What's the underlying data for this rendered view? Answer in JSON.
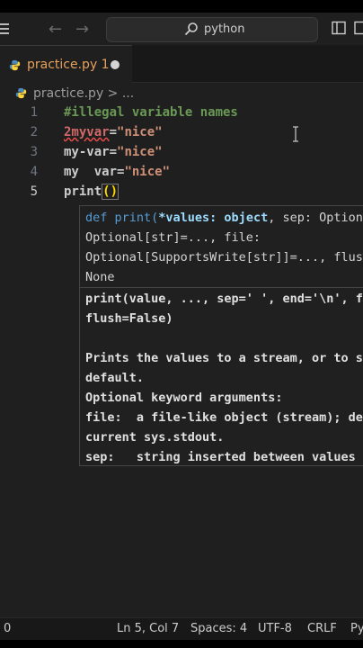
{
  "titlebar": {
    "search_text": "python",
    "menu_icon": "hamburger-menu-icon",
    "back_icon": "arrow-left-icon",
    "forward_icon": "arrow-right-icon",
    "search_icon": "search-icon",
    "layout_icon": "layout-sidebar-icon"
  },
  "tab": {
    "label": "practice.py 1",
    "modified_dot": "●"
  },
  "breadcrumb": {
    "text": "practice.py > ..."
  },
  "editor": {
    "lines": [
      {
        "num": "1",
        "text": "#illegal variable names"
      },
      {
        "num": "2",
        "err": "2myvar",
        "rest_def": "=",
        "str": "\"nice\""
      },
      {
        "num": "3",
        "def": "my-var=",
        "str": "\"nice\""
      },
      {
        "num": "4",
        "def": "my  var=",
        "str": "\"nice\""
      },
      {
        "num": "5",
        "fn": "print",
        "paren": "()"
      }
    ]
  },
  "hover": {
    "sig_l1_a": "def print(",
    "sig_l1_b": "*values: object",
    "sig_l1_c": ", sep: Optional",
    "sig_l2": "Optional[str]=..., file:",
    "sig_l3": "Optional[SupportsWrite[str]]=..., flush",
    "sig_l4": "None",
    "doc_l1": "print(value, ..., sep=' ', end='\\n', file",
    "doc_l2": "flush=False)",
    "doc_l3": "",
    "doc_l4": "Prints the values to a stream, or to sys",
    "doc_l5": "default.",
    "doc_l6": "Optional keyword arguments:",
    "doc_l7": "file:  a file-like object (stream); defau",
    "doc_l8": "current sys.stdout.",
    "doc_l9": "sep:   string inserted between values"
  },
  "statusbar": {
    "left": "0",
    "position": "Ln 5, Col 7",
    "spaces": "Spaces: 4",
    "encoding": "UTF-8",
    "eol": "CRLF",
    "lang": "Py"
  },
  "colors": {
    "background": "#1f1f1f",
    "tab_modified": "#e5a15a",
    "error": "#d16969",
    "string": "#ce9178"
  }
}
